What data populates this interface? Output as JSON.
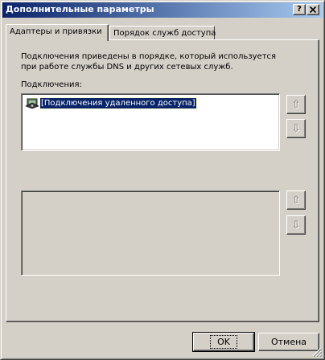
{
  "window": {
    "title": "Дополнительные параметры",
    "help_label": "?",
    "close_label": "X"
  },
  "tabs": [
    {
      "label": "Адаптеры и привязки",
      "active": true
    },
    {
      "label": "Порядок служб доступа",
      "active": false
    }
  ],
  "panel": {
    "description_line1": "Подключения приведены в порядке, который используется",
    "description_line2": "при работе службы DNS и других сетевых служб.",
    "connections_label": "Подключения:",
    "connections": [
      {
        "label": "[Подключения удаленного доступа]",
        "selected": true,
        "icon": "network-connection-icon"
      }
    ],
    "bindings": []
  },
  "buttons": {
    "ok": "OK",
    "cancel": "Отмена"
  },
  "icons": {
    "up": "arrow-up-icon",
    "down": "arrow-down-icon"
  },
  "colors": {
    "titlebar_start": "#0a246a",
    "titlebar_end": "#a6caf0",
    "face": "#d4d0c8",
    "selection": "#0a246a"
  }
}
